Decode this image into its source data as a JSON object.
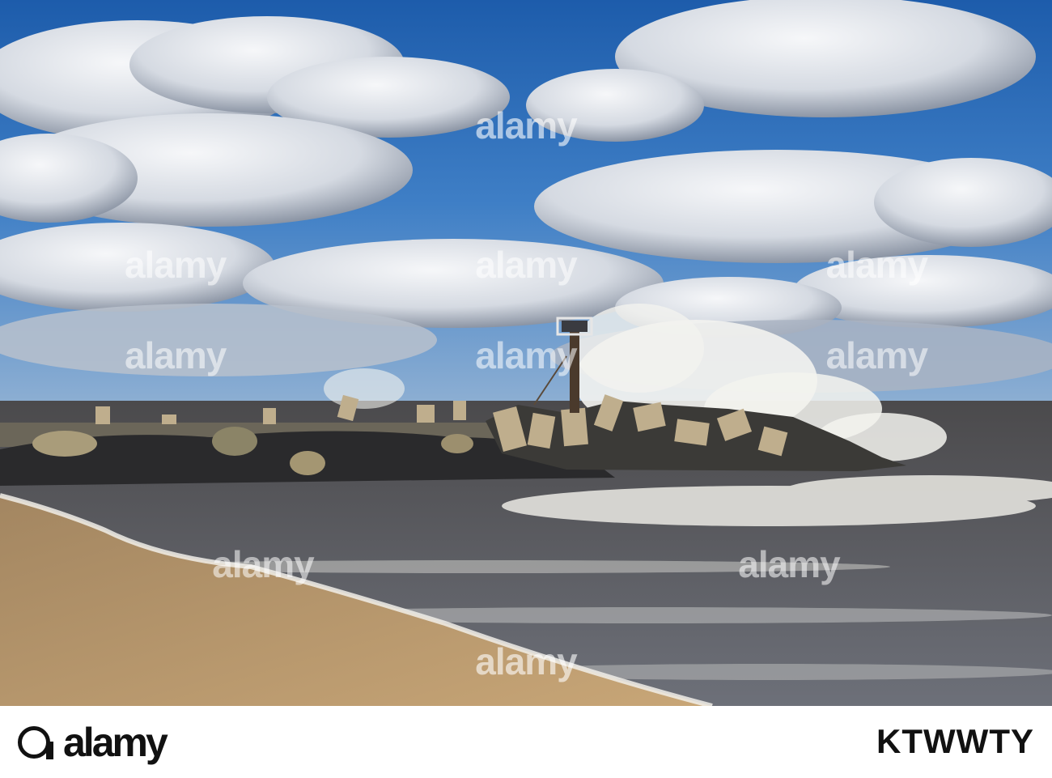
{
  "photo": {
    "subject": "Stormy sea waves crashing over a concrete-block jetty with a navigation marker, sandy beach in foreground",
    "colors": {
      "sky_top": "#1a5aa8",
      "sky_mid": "#3b7bc4",
      "cloud": "#e9edf2",
      "cloud_shadow": "#8d97a6",
      "sea": "#5a5d66",
      "foam": "#f4f4f2",
      "sand": "#b8976a",
      "wet_sand": "#8f7452",
      "rock": "#2a2a2c",
      "block": "#b9a889"
    }
  },
  "watermark": {
    "text": "alamy"
  },
  "footer": {
    "logo_text": "alamy",
    "stock_id": "KTWWTY"
  }
}
